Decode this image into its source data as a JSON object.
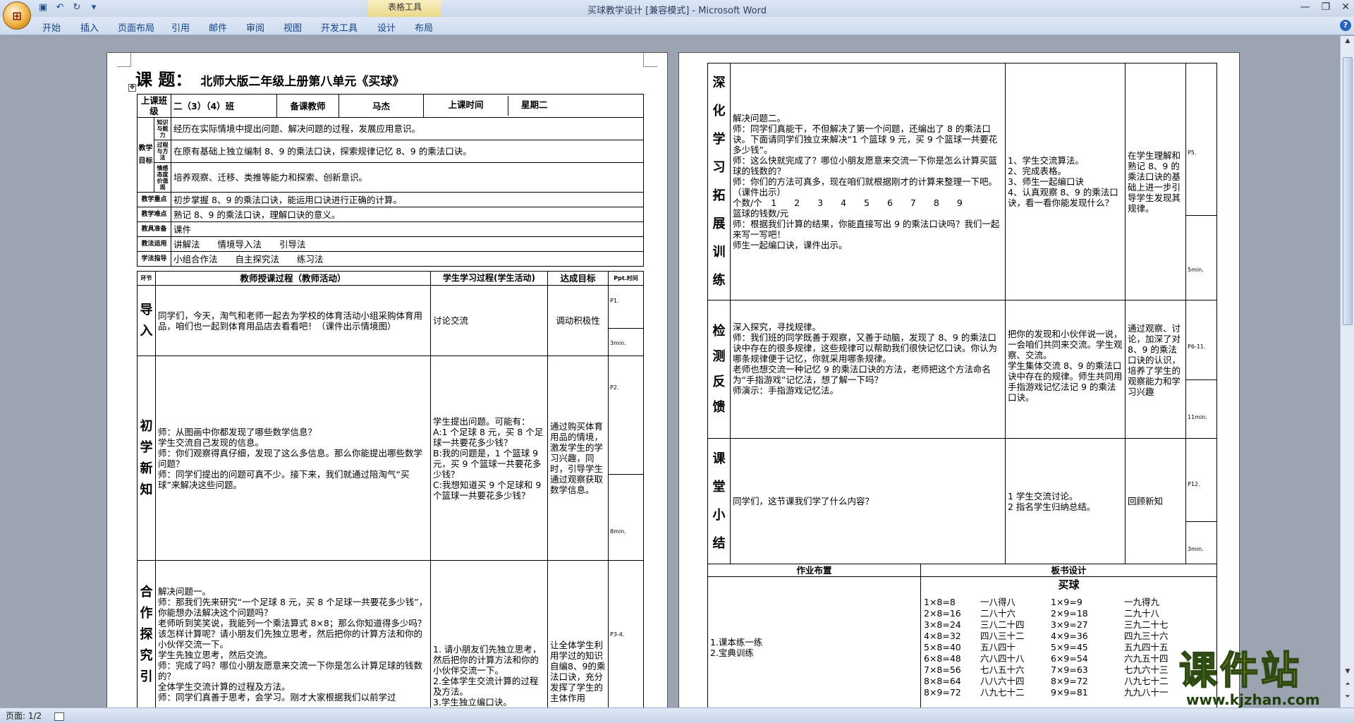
{
  "window": {
    "title": "买球教学设计 [兼容模式] - Microsoft Word",
    "context_tab": "表格工具",
    "tabs": [
      "开始",
      "插入",
      "页面布局",
      "引用",
      "邮件",
      "审阅",
      "视图",
      "开发工具",
      "设计",
      "布局"
    ]
  },
  "status": {
    "page": "页面: 1/2"
  },
  "page1": {
    "title_prefix": "课 题：",
    "title": "北师大版二年级上册第八单元《买球》",
    "info": {
      "class_label": "上课班级",
      "class_value": "二（3）（4）班",
      "teacher_label": "备课教师",
      "teacher_value": "马杰",
      "time_label": "上课时间",
      "time_value": "星期二"
    },
    "goals": {
      "group": "教学目标",
      "rows": [
        {
          "sub": "知识与能力",
          "text": "经历在实际情境中提出问题、解决问题的过程，发展应用意识。"
        },
        {
          "sub": "过程与方法",
          "text": "在原有基础上独立编制 8、9 的乘法口诀，探索规律记忆 8、9 的乘法口诀。"
        },
        {
          "sub": "情感态度价值观",
          "text": "培养观察、迁移、类推等能力和探索、创新意识。"
        }
      ]
    },
    "meta": [
      {
        "label": "教学重点",
        "text": "初步掌握 8、9 的乘法口诀，能运用口诀进行正确的计算。"
      },
      {
        "label": "教学难点",
        "text": "熟记 8、9 的乘法口诀，理解口诀的意义。"
      },
      {
        "label": "教具准备",
        "text": "课件"
      },
      {
        "label": "教法运用",
        "text": "讲解法　　情境导入法　　引导法"
      },
      {
        "label": "学法指导",
        "text": "小组合作法　　自主探究法　　练习法"
      }
    ],
    "header": {
      "stage": "环节",
      "teacher": "教师授课过程（教师活动）",
      "student": "学生学习过程(学生活动)",
      "goal": "达成目标",
      "time": "Ppt.时间"
    },
    "stages": [
      {
        "name": "导入",
        "teacher": "同学们，今天，淘气和老师一起去为学校的体育活动小组采购体育用品，咱们也一起到体育用品店去看看吧！（课件出示情境图）",
        "student": "讨论交流",
        "goal": "调动积极性",
        "ppt": "P1.",
        "time": "3min."
      },
      {
        "name": "初学新知",
        "teacher": "师：从图画中你都发现了哪些数学信息？\n学生交流自己发现的信息。\n师：你们观察得真仔细，发现了这么多信息。那么你能提出哪些数学问题？\n师：同学们提出的问题可真不少。接下来，我们就通过陪淘气“买球”来解决这些问题。",
        "student": "学生提出问题。可能有：\nA:1 个足球 8 元，买 8 个足球一共要花多少钱？\nB:我的问题是，1 个篮球 9 元，买 9 个篮球一共要花多少钱？\nC:我想知道买 9 个足球和 9 个篮球一共要花多少钱？",
        "goal": "通过购买体育用品的情境，激发学生的学习兴趣，同时，引导学生通过观察获取数学信息。",
        "ppt": "P2.",
        "time": "8min."
      },
      {
        "name": "合作探究引",
        "teacher": "解决问题一。\n师：那我们先来研究“一个足球 8 元，买 8 个足球一共要花多少钱”，你能想办法解决这个问题吗？\n老师听到笑笑说，我能列一个乘法算式 8×8；那么你知道得多少吗？该怎样计算呢？请小朋友们先独立思考，然后把你的计算方法和你的小伙伴交流一下。\n学生先独立思考，然后交流。\n师：完成了吗？哪位小朋友愿意来交流一下你是怎么计算足球的钱数的？\n全体学生交流计算的过程及方法。\n师：同学们真善于思考，会学习。刚才大家根据我们以前学过",
        "student": "1. 请小朋友们先独立思考，然后把你的计算方法和你的小伙伴交流一下。\n2.全体学生交流计算的过程及方法。\n3.学生独立编口诀。",
        "goal": "让全体学生利用学过的知识自编8、9的乘法口诀，充分发挥了学生的主体作用",
        "ppt": "P3-4.",
        "time": ""
      }
    ]
  },
  "page2": {
    "stages": [
      {
        "name": "深化学习拓展训练",
        "teacher": "解决问题二。\n师：同学们真能干，不但解决了第一个问题，还编出了 8 的乘法口诀。下面请同学们独立来解决“1 个篮球 9 元，买 9 个篮球一共要花多少钱”。\n师：这么快就完成了？哪位小朋友愿意来交流一下你是怎么计算买篮球的钱数的？\n师：你们的方法可真多，现在咱们就根据刚才的计算来整理一下吧。（课件出示）\n个数/个　1　　2　　3　　4　　5　　6　　7　　8　　9\n篮球的钱数/元\n师：根据我们计算的结果，你能直接写出 9 的乘法口诀吗？我们一起来写一写吧！\n师生一起编口诀，课件出示。",
        "student": "1、学生交流算法。\n2、完成表格。\n3、师生一起编口诀\n4、认真观察 8、9 的乘法口诀，看一看你能发现什么？",
        "goal": "在学生理解和熟记 8、9 的乘法口诀的基础上进一步引导学生发现其规律。",
        "ppt": "P5.",
        "time": "5min."
      },
      {
        "name": "检测反馈",
        "teacher": "深入探究，寻找规律。\n师：我们班的同学既善于观察，又善于动脑，发现了 8、9 的乘法口诀中存在的很多规律，这些规律可以帮助我们很快记忆口诀。你认为哪条规律便于记忆，你就采用哪条规律。\n老师也想交流一种记忆 9 的乘法口诀的方法，老师把这个方法命名为“手指游戏”记忆法，想了解一下吗？\n师演示：手指游戏记忆法。",
        "student": "把你的发现和小伙伴说一说，一会咱们共同来交流。学生观察、交流。\n学生集体交流 8、9 的乘法口诀中存在的规律。师生共同用手指游戏记忆法记 9 的乘法口诀。",
        "goal": "通过观察、讨论，加深了对 8、9 的乘法口诀的认识，培养了学生的观察能力和学习兴趣",
        "ppt": "P6-11.",
        "time": "11min."
      },
      {
        "name": "课堂小结",
        "teacher": "同学们，这节课我们学了什么内容？",
        "student": "1 学生交流讨论。\n2 指名学生归纳总结。",
        "goal": "回顾新知",
        "ppt": "P12.",
        "time": "3min."
      }
    ],
    "homework": {
      "label": "作业布置",
      "items": "1.课本练一练\n2.宝典训练"
    },
    "board": {
      "label": "板书设计",
      "title": "买球",
      "eight": [
        {
          "eq": "1×8=8",
          "rhyme": "一八得八"
        },
        {
          "eq": "2×8=16",
          "rhyme": "二八十六"
        },
        {
          "eq": "3×8=24",
          "rhyme": "三八二十四"
        },
        {
          "eq": "4×8=32",
          "rhyme": "四八三十二"
        },
        {
          "eq": "5×8=40",
          "rhyme": "五八四十"
        },
        {
          "eq": "6×8=48",
          "rhyme": "六八四十八"
        },
        {
          "eq": "7×8=56",
          "rhyme": "七八五十六"
        },
        {
          "eq": "8×8=64",
          "rhyme": "八八六十四"
        },
        {
          "eq": "8×9=72",
          "rhyme": "八九七十二"
        }
      ],
      "nine": [
        {
          "eq": "1×9=9",
          "rhyme": "一九得九"
        },
        {
          "eq": "2×9=18",
          "rhyme": "二九十八"
        },
        {
          "eq": "3×9=27",
          "rhyme": "三九二十七"
        },
        {
          "eq": "4×9=36",
          "rhyme": "四九三十六"
        },
        {
          "eq": "5×9=45",
          "rhyme": "五九四十五"
        },
        {
          "eq": "6×9=54",
          "rhyme": "六九五十四"
        },
        {
          "eq": "7×9=63",
          "rhyme": "七九六十三"
        },
        {
          "eq": "8×9=72",
          "rhyme": "八九七十二"
        },
        {
          "eq": "9×9=81",
          "rhyme": "九九八十一"
        }
      ]
    }
  },
  "watermark": {
    "brand": "课件站",
    "url": "www.kjzhan.com"
  }
}
